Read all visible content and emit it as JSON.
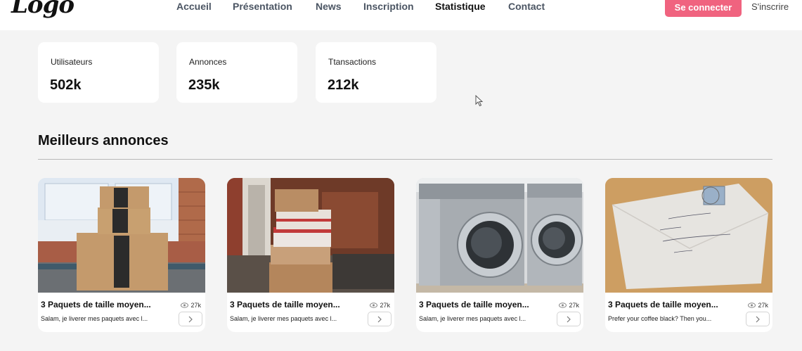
{
  "header": {
    "logo": "Logo",
    "nav": [
      {
        "label": "Accueil",
        "active": false
      },
      {
        "label": "Présentation",
        "active": false
      },
      {
        "label": "News",
        "active": false
      },
      {
        "label": "Inscription",
        "active": false
      },
      {
        "label": "Statistique",
        "active": true
      },
      {
        "label": "Contact",
        "active": false
      }
    ],
    "login_label": "Se connecter",
    "register_label": "S'inscrire"
  },
  "stats": [
    {
      "label": "Utilisateurs",
      "value": "502k"
    },
    {
      "label": "Annonces",
      "value": "235k"
    },
    {
      "label": "Ttansactions",
      "value": "212k"
    }
  ],
  "section": {
    "title": "Meilleurs annonces"
  },
  "listings": [
    {
      "title": "3 Paquets de taille moyen...",
      "views": "27k",
      "description": "Salam, je liverer mes paquets avec l...",
      "image": "stacked-boxes-photo"
    },
    {
      "title": "3 Paquets de taille moyen...",
      "views": "27k",
      "description": "Salam, je liverer mes paquets avec l...",
      "image": "doorstep-packages-photo"
    },
    {
      "title": "3 Paquets de taille moyen...",
      "views": "27k",
      "description": "Salam, je liverer mes paquets avec l...",
      "image": "washer-dryer-photo"
    },
    {
      "title": "3 Paquets de taille moyen...",
      "views": "27k",
      "description": "Prefer your coffee black? Then you...",
      "image": "envelope-photo"
    }
  ],
  "colors": {
    "accent": "#f0637f",
    "background": "#f4f4f4"
  }
}
